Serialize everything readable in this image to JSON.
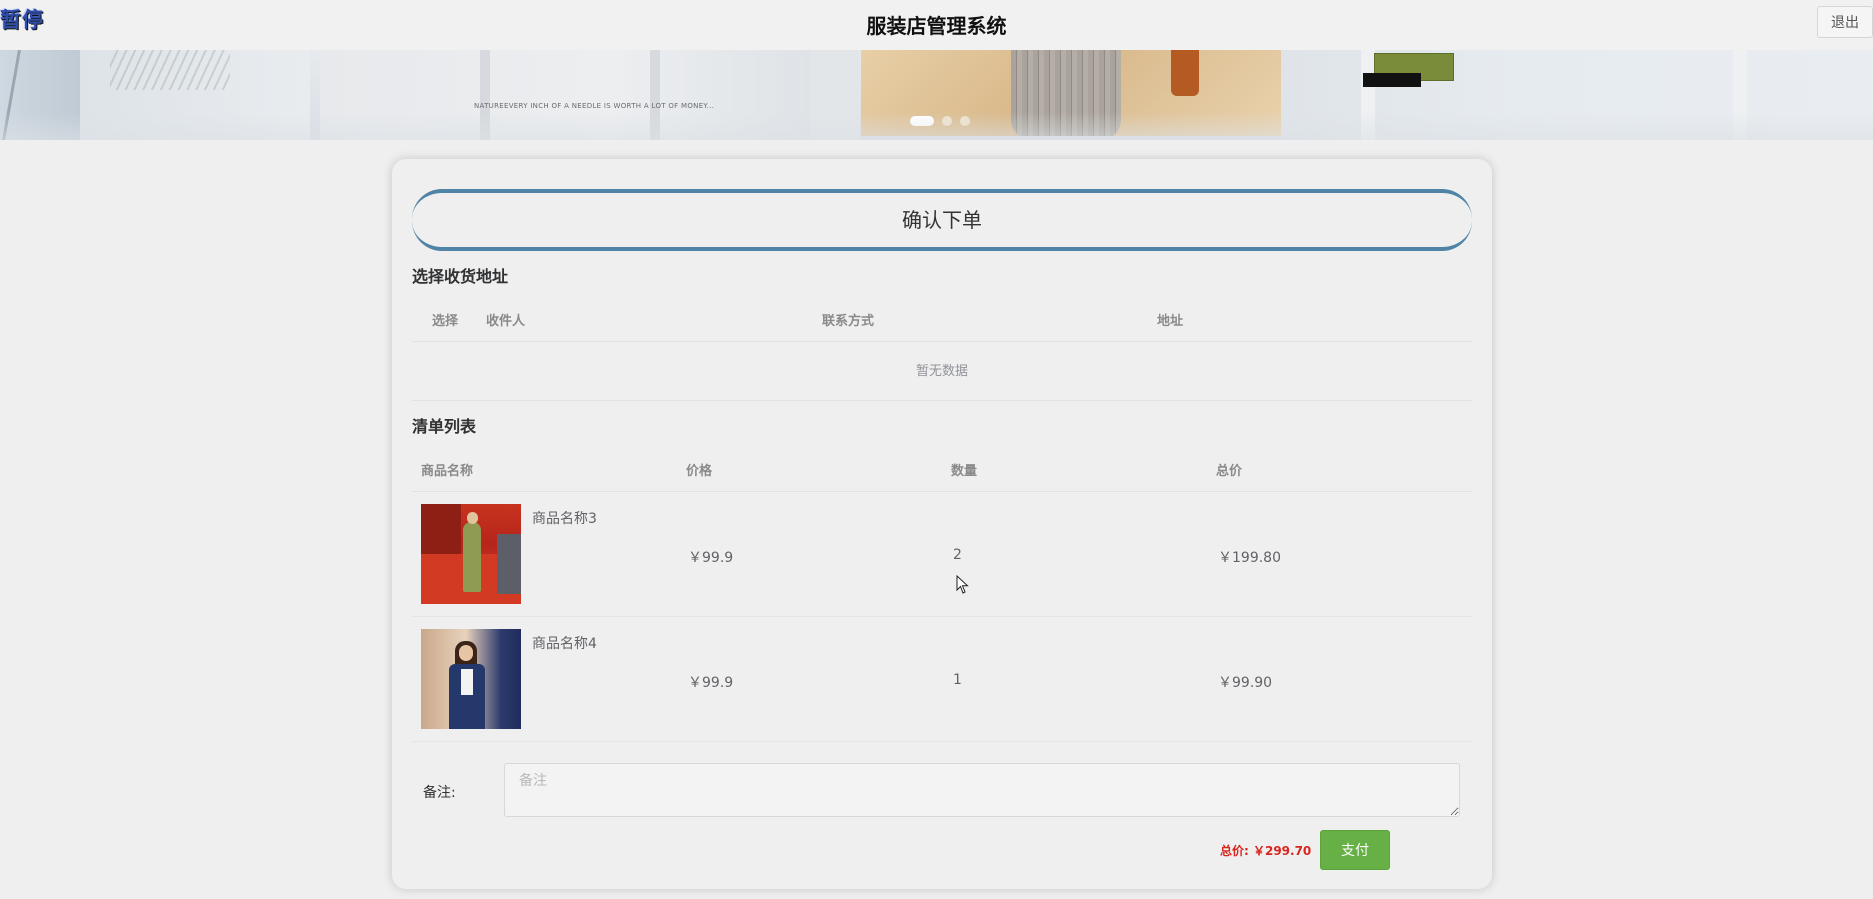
{
  "header": {
    "pause_label": "暂停",
    "app_title": "服装店管理系统",
    "logout_label": "退出"
  },
  "banner": {
    "caption": "NATUREEVERY INCH OF A NEEDLE IS WORTH A LOT OF MONEY...",
    "slide_count": 3,
    "active_slide": 1
  },
  "order": {
    "title": "确认下单",
    "address_section_title": "选择收货地址",
    "address_columns": [
      "选择",
      "收件人",
      "联系方式",
      "地址"
    ],
    "address_empty_text": "暂无数据",
    "list_section_title": "清单列表",
    "list_columns": [
      "商品名称",
      "价格",
      "数量",
      "总价"
    ],
    "items": [
      {
        "name": "商品名称3",
        "price": "￥99.9",
        "quantity": "2",
        "total": "￥199.80"
      },
      {
        "name": "商品名称4",
        "price": "￥99.9",
        "quantity": "1",
        "total": "￥99.90"
      }
    ],
    "remark_label": "备注:",
    "remark_placeholder": "备注",
    "remark_value": "",
    "grand_total_text": "总价: ￥299.70",
    "pay_label": "支付"
  },
  "colors": {
    "title_border": "#4f84a6",
    "pay_button": "#67b045",
    "total_text": "#d9251d",
    "pause_badge": "#2f4ea8"
  }
}
